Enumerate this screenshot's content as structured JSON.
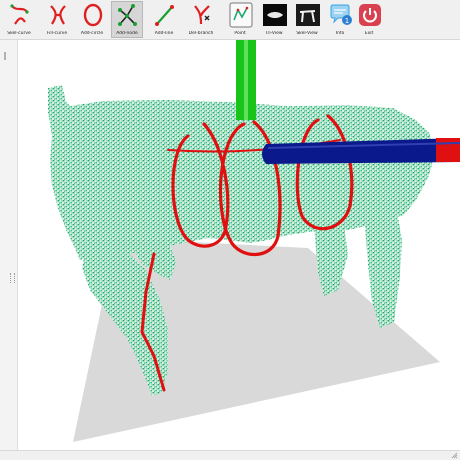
{
  "toolbar": {
    "tools": [
      {
        "label": "Skel-curve",
        "icon": "curve-skeleton-icon",
        "active": false
      },
      {
        "label": "Fill-curve",
        "icon": "branch-curve-icon",
        "active": false
      },
      {
        "label": "Add-circle",
        "icon": "circle-icon",
        "active": false
      },
      {
        "label": "Add-node",
        "icon": "node-graph-icon",
        "active": true
      },
      {
        "label": "Add-line",
        "icon": "line-segment-icon",
        "active": false
      },
      {
        "label": "Del-branch",
        "icon": "delete-branch-icon",
        "active": false
      },
      {
        "label": "Point",
        "icon": "point-view-icon",
        "active": false
      },
      {
        "label": "Tri-View",
        "icon": "dark-view-icon",
        "active": false
      },
      {
        "label": "Skel-View",
        "icon": "skeleton-view-icon",
        "active": false
      },
      {
        "label": "Info",
        "icon": "chat-info-icon",
        "active": false
      },
      {
        "label": "Exit",
        "icon": "power-icon",
        "active": false
      }
    ]
  },
  "colors": {
    "point_cloud": "#1aa86b",
    "skeleton": "#e01010",
    "axis_y": "#17c417",
    "axis_x": "#0a1a8c",
    "ground": "#d9d9d9",
    "exit_button": "#d9414f",
    "info_button": "#3ea0e0"
  }
}
